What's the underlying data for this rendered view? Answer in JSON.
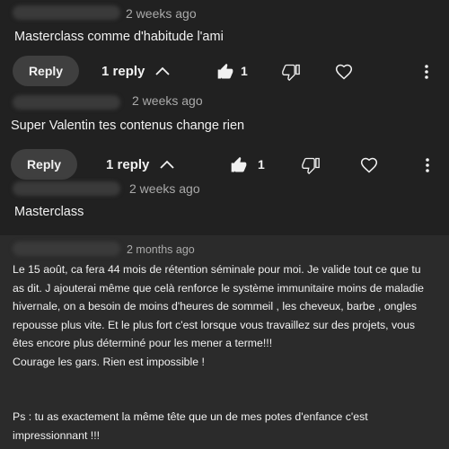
{
  "comments": [
    {
      "time": "2 weeks ago",
      "text": "Masterclass comme d'habitude l'ami",
      "reply_label": "Reply",
      "replies_label": "1 reply",
      "likes": "1"
    },
    {
      "time": "2 weeks ago",
      "text": "Super Valentin tes contenus change rien",
      "reply_label": "Reply",
      "replies_label": "1 reply",
      "likes": "1"
    },
    {
      "time": "2 weeks ago",
      "text": "Masterclass"
    },
    {
      "time": "2 months ago",
      "lines": [
        "Le 15 août, ca fera 44 mois de rétention séminale pour moi. Je valide tout ce que tu",
        "as dit. J ajouterai même que celà renforce le système immunitaire moins de maladie",
        "hivernale, on a besoin de moins d'heures de sommeil , les cheveux, barbe , ongles",
        "repousse plus vite. Et le plus fort c'est lorsque vous travaillez sur des projets, vous",
        "êtes encore plus déterminé pour les mener a terme!!!",
        "Courage les gars. Rien est impossible !",
        "",
        "",
        "Ps : tu as exactement la même tête que un de mes potes d'enfance c'est",
        "impressionnant !!!"
      ]
    }
  ],
  "icons": {
    "like": "thumbs-up-filled-icon",
    "dislike": "thumbs-down-icon",
    "heart": "heart-outline-icon",
    "more": "more-vertical-icon",
    "chevron": "chevron-up-icon"
  }
}
